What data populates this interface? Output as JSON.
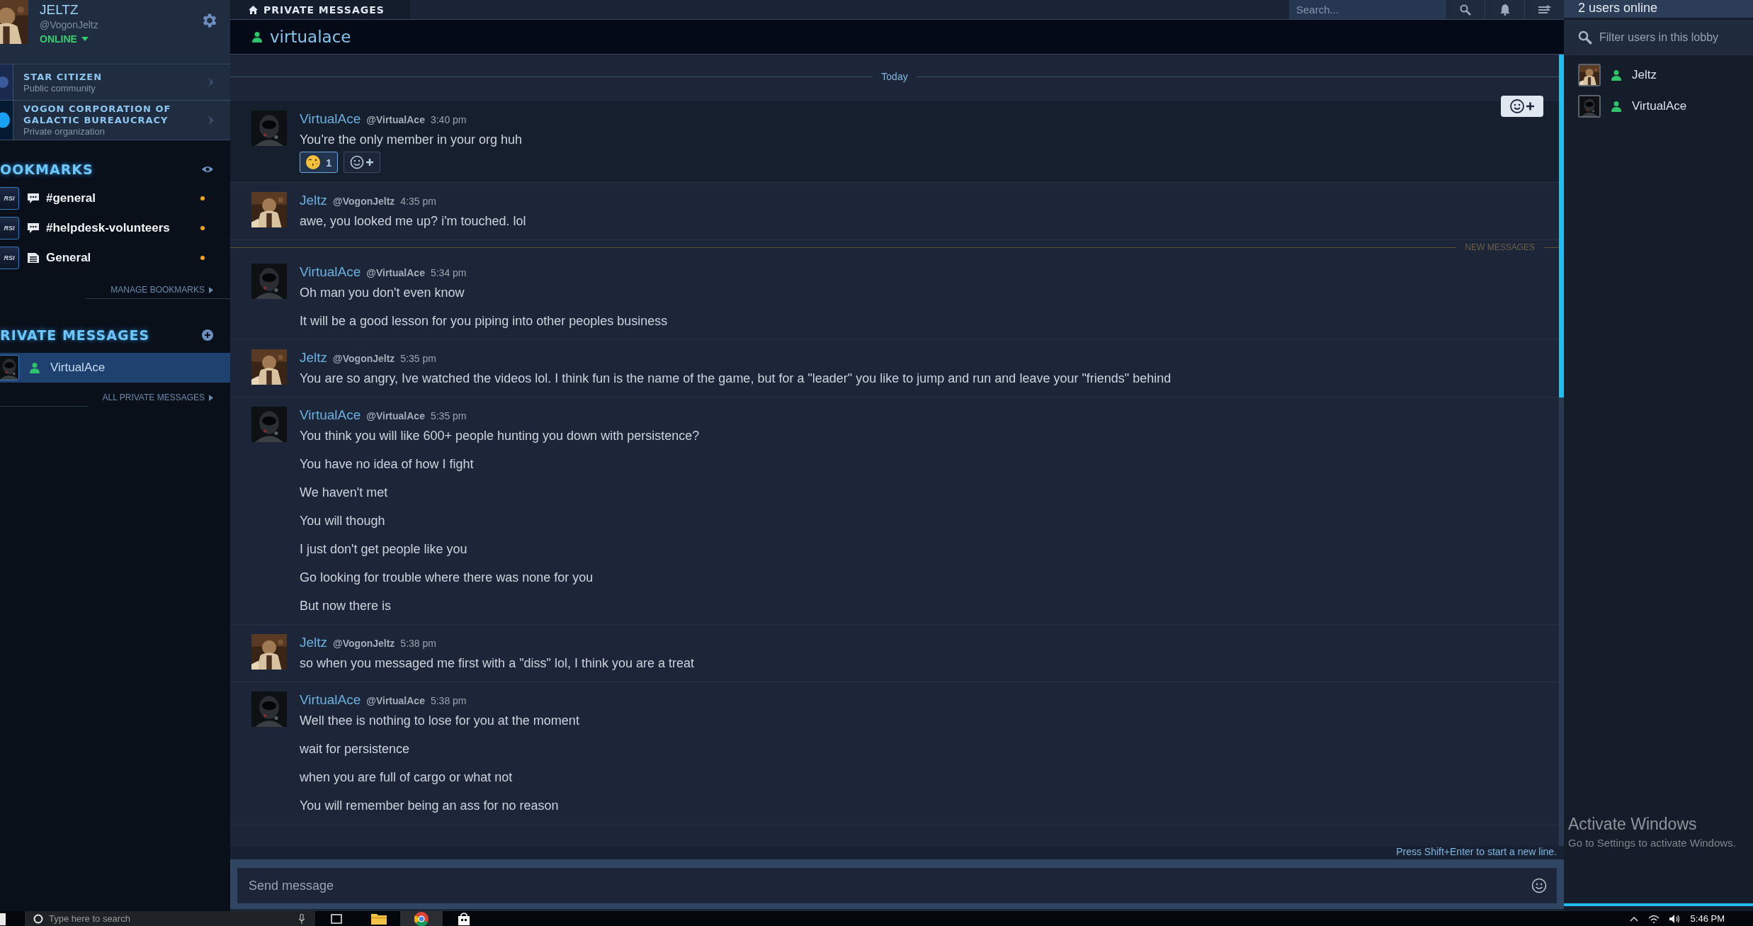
{
  "user": {
    "name": "JELTZ",
    "handle": "@VogonJeltz",
    "status": "ONLINE"
  },
  "communities": [
    {
      "name": "STAR CITIZEN",
      "type": "Public community"
    },
    {
      "name": "VOGON CORPORATION OF GALACTIC BUREAUCRACY",
      "type": "Private organization"
    }
  ],
  "bookmarks": {
    "title": "OOKMARKS",
    "manage_link": "MANAGE BOOKMARKS",
    "items": [
      {
        "badge": "RSI",
        "kind": "chat",
        "label": "#general",
        "unread": true
      },
      {
        "badge": "RSI",
        "kind": "chat",
        "label": "#helpdesk-volunteers",
        "unread": true
      },
      {
        "badge": "RSI",
        "kind": "forum",
        "label": "General",
        "unread": true
      }
    ]
  },
  "private_messages": {
    "title": "RIVATE MESSAGES",
    "all_link": "ALL PRIVATE MESSAGES",
    "items": [
      {
        "label": "VirtualAce",
        "online": true,
        "selected": true
      }
    ]
  },
  "top_bar": {
    "tab": "PRIVATE MESSAGES",
    "search": {
      "placeholder": "Search..."
    }
  },
  "channel": {
    "title": "virtualace",
    "online": true
  },
  "timeline": [
    {
      "kind": "date",
      "label": "Today"
    },
    {
      "kind": "message",
      "own": false,
      "hovered": true,
      "author": "VirtualAce",
      "handle": "@VirtualAce",
      "time": "3:40 pm",
      "lines": [
        "You're the only member in your org huh"
      ],
      "reactions": [
        {
          "count": "1",
          "selected": true
        }
      ]
    },
    {
      "kind": "message",
      "own": true,
      "hovered": false,
      "author": "Jeltz",
      "handle": "@VogonJeltz",
      "time": "4:35 pm",
      "lines": [
        "awe, you looked me up? i'm touched. lol"
      ]
    },
    {
      "kind": "new",
      "label": "NEW MESSAGES"
    },
    {
      "kind": "message",
      "own": false,
      "hovered": false,
      "author": "VirtualAce",
      "handle": "@VirtualAce",
      "time": "5:34 pm",
      "lines": [
        "Oh man you don't even know",
        "It will be a good lesson for you piping into other peoples business"
      ]
    },
    {
      "kind": "message",
      "own": true,
      "hovered": false,
      "author": "Jeltz",
      "handle": "@VogonJeltz",
      "time": "5:35 pm",
      "lines": [
        "You are so angry, Ive watched the videos lol. I think fun is the name of the game, but for a \"leader\" you like to jump and run and leave your \"friends\" behind"
      ]
    },
    {
      "kind": "message",
      "own": false,
      "hovered": false,
      "author": "VirtualAce",
      "handle": "@VirtualAce",
      "time": "5:35 pm",
      "lines": [
        "You think you will like 600+ people hunting you down with persistence?",
        "You have no idea of how I fight",
        "We haven't met",
        "You will though",
        "I just don't get people like you",
        "Go looking for trouble where there was none for you",
        "But now there is"
      ]
    },
    {
      "kind": "message",
      "own": true,
      "hovered": false,
      "author": "Jeltz",
      "handle": "@VogonJeltz",
      "time": "5:38 pm",
      "lines": [
        "so when you messaged me first with a \"diss\" lol, I think you are a treat"
      ]
    },
    {
      "kind": "message",
      "own": false,
      "hovered": false,
      "author": "VirtualAce",
      "handle": "@VirtualAce",
      "time": "5:38 pm",
      "lines": [
        "Well thee is nothing to lose for you at the moment",
        "wait for persistence",
        "when you are full of cargo or what not",
        "You will remember being an ass for no reason"
      ]
    }
  ],
  "composer": {
    "hint": "Press Shift+Enter to start a new line.",
    "placeholder": "Send message"
  },
  "users_panel": {
    "title": "2 users online",
    "filter": {
      "placeholder": "Filter users in this lobby"
    },
    "users": [
      {
        "name": "Jeltz",
        "own": true,
        "online": true
      },
      {
        "name": "VirtualAce",
        "own": false,
        "online": true
      }
    ]
  },
  "os_notice": {
    "title": "Activate Windows",
    "text": "Go to Settings to activate Windows."
  },
  "taskbar": {
    "search": {
      "placeholder": "Type here to search"
    },
    "time": "5:46 PM"
  }
}
